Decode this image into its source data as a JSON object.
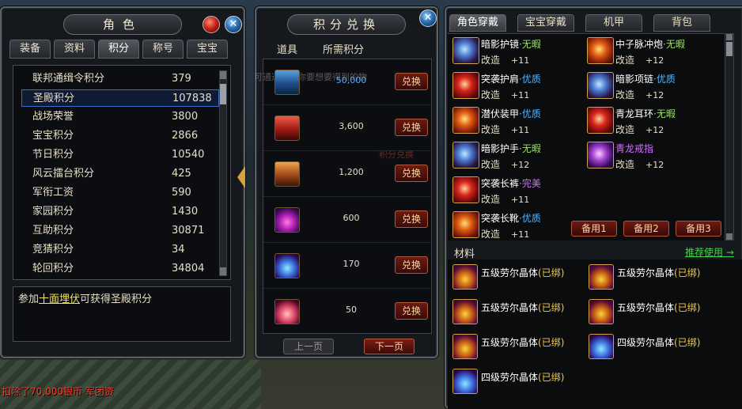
{
  "left_panel": {
    "title": "角色",
    "tabs": [
      "装备",
      "资料",
      "积分",
      "称号",
      "宝宝"
    ],
    "scores": [
      {
        "name": "联邦通缉令积分",
        "value": "379"
      },
      {
        "name": "圣殿积分",
        "value": "107838"
      },
      {
        "name": "战场荣誉",
        "value": "3800"
      },
      {
        "name": "宝宝积分",
        "value": "2866"
      },
      {
        "name": "节日积分",
        "value": "10540"
      },
      {
        "name": "风云擂台积分",
        "value": "425"
      },
      {
        "name": "军衔工资",
        "value": "590"
      },
      {
        "name": "家园积分",
        "value": "1430"
      },
      {
        "name": "互助积分",
        "value": "30871"
      },
      {
        "name": "竞猜积分",
        "value": "34"
      },
      {
        "name": "轮回积分",
        "value": "34804"
      }
    ],
    "desc_prefix": "参加",
    "desc_link": "十面埋伏",
    "desc_suffix": "可获得圣殿积分"
  },
  "mid_panel": {
    "title": "积分兑换",
    "col_item": "道具",
    "col_cost": "所需积分",
    "rows": [
      {
        "cost": "50,000",
        "icon": "blue-chest-icon",
        "button": "兑换"
      },
      {
        "cost": "3,600",
        "icon": "red-chest-icon",
        "button": "兑换"
      },
      {
        "cost": "1,200",
        "icon": "orange-chest-icon",
        "button": "兑换"
      },
      {
        "cost": "600",
        "icon": "purple-crystal-icon",
        "button": "兑换"
      },
      {
        "cost": "170",
        "icon": "blue-crystal-icon",
        "button": "兑换"
      },
      {
        "cost": "50",
        "icon": "pink-crystal-icon",
        "button": "兑换"
      }
    ],
    "ghost_text_1": "可通过消耗你要想要得到的物",
    "ghost_text_2": "积分兑换",
    "prev_page": "上一页",
    "next_page": "下一页"
  },
  "right_panel": {
    "tabs": [
      "角色穿戴",
      "宝宝穿戴",
      "机甲",
      "背包"
    ],
    "equipment": [
      {
        "name": "暗影护镜",
        "quality": "无暇",
        "quality_class": "q-none",
        "sub": "改造",
        "level": "+11"
      },
      {
        "name": "中子脉冲炮",
        "quality": "无暇",
        "quality_class": "q-none",
        "sub": "改造",
        "level": "+12"
      },
      {
        "name": "突袭护肩",
        "quality": "优质",
        "quality_class": "q-good",
        "sub": "改造",
        "level": "+11"
      },
      {
        "name": "暗影项链",
        "quality": "优质",
        "quality_class": "q-good",
        "sub": "改造",
        "level": "+12"
      },
      {
        "name": "潜伏装甲",
        "quality": "优质",
        "quality_class": "q-good",
        "sub": "改造",
        "level": "+11"
      },
      {
        "name": "青龙耳环",
        "quality": "无暇",
        "quality_class": "q-none",
        "sub": "改造",
        "level": "+12"
      },
      {
        "name": "暗影护手",
        "quality": "无暇",
        "quality_class": "q-none",
        "sub": "改造",
        "level": "+12"
      },
      {
        "name": "青龙戒指",
        "quality": "",
        "quality_class": "q-none",
        "sub": "改造",
        "level": "+12"
      },
      {
        "name": "突袭长裤",
        "quality": "完美",
        "quality_class": "q-perfect",
        "sub": "改造",
        "level": "+11"
      },
      {
        "name": "突袭长靴",
        "quality": "优质",
        "quality_class": "q-good",
        "sub": "改造",
        "level": "+11"
      }
    ],
    "backup_buttons": [
      "备用1",
      "备用2",
      "备用3"
    ],
    "materials_label": "材料",
    "recommend_link": "推荐使用 →",
    "materials": [
      {
        "name": "五级劳尔晶体",
        "bound": "(已绑)",
        "gem": "yellow"
      },
      {
        "name": "五级劳尔晶体",
        "bound": "(已绑)",
        "gem": "yellow"
      },
      {
        "name": "五级劳尔晶体",
        "bound": "(已绑)",
        "gem": "yellow"
      },
      {
        "name": "五级劳尔晶体",
        "bound": "(已绑)",
        "gem": "yellow"
      },
      {
        "name": "五级劳尔晶体",
        "bound": "(已绑)",
        "gem": "yellow"
      },
      {
        "name": "四级劳尔晶体",
        "bound": "(已绑)",
        "gem": "blue"
      },
      {
        "name": "四级劳尔晶体",
        "bound": "(已绑)",
        "gem": "blue"
      }
    ]
  },
  "system_message": "扣除了70,000银币 军团资"
}
